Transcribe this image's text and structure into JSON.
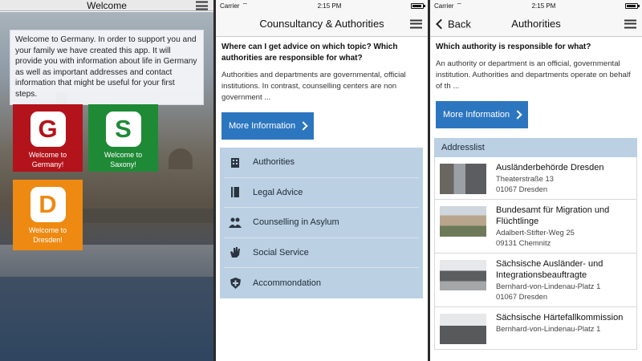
{
  "status": {
    "carrier": "Carrier",
    "time": "2:15 PM"
  },
  "screen1": {
    "title": "Welcome",
    "intro": "Welcome to Germany. In order to support you and your family we have created this app. It will provide you with information about life in Germany as well as important addresses and contact information that might be useful for your first steps.",
    "tiles": [
      {
        "letter": "G",
        "label1": "Welcome to",
        "label2": "Germany!",
        "color": "#b3131a"
      },
      {
        "letter": "S",
        "label1": "Welcome to",
        "label2": "Saxony!",
        "color": "#1f8a36"
      },
      {
        "letter": "D",
        "label1": "Welcome to",
        "label2": "Dresden!",
        "color": "#ee8a12"
      }
    ]
  },
  "screen2": {
    "title": "Counsultancy & Authorities",
    "question": "Where can I get advice on which topic? Which authorities are responsible for what?",
    "paragraph": "Authorities and departments are governmental, official institutions. In contrast, counselling centers are non government ...",
    "more_label": "More Information",
    "menu": [
      {
        "label": "Authorities",
        "icon": "building-icon"
      },
      {
        "label": "Legal Advice",
        "icon": "book-icon"
      },
      {
        "label": "Counselling in Asylum",
        "icon": "people-icon"
      },
      {
        "label": "Social Service",
        "icon": "hand-icon"
      },
      {
        "label": "Accommondation",
        "icon": "shield-icon"
      }
    ]
  },
  "screen3": {
    "back_label": "Back",
    "title": "Authorities",
    "question": "Which authority is responsible for what?",
    "paragraph": "An authority or department is an official, governmental institution. Authorities and departments operate on behalf of th ...",
    "more_label": "More Information",
    "addresslist_label": "Addresslist",
    "addresses": [
      {
        "name": "Ausländerbehörde Dresden",
        "street": "Theaterstraße 13",
        "city": "01067 Dresden"
      },
      {
        "name": "Bundesamt für Migration und Flüchtlinge",
        "street": "Adalbert-Stifter-Weg 25",
        "city": "09131 Chemnitz"
      },
      {
        "name": "Sächsische Ausländer- und Integrationsbeauftragte",
        "street": "Bernhard-von-Lindenau-Platz 1",
        "city": "01067 Dresden"
      },
      {
        "name": "Sächsische Härtefallkommission",
        "street": "Bernhard-von-Lindenau-Platz 1",
        "city": ""
      }
    ]
  },
  "colors": {
    "accent": "#2c76c0",
    "menu_bg": "#bcd0e3"
  }
}
